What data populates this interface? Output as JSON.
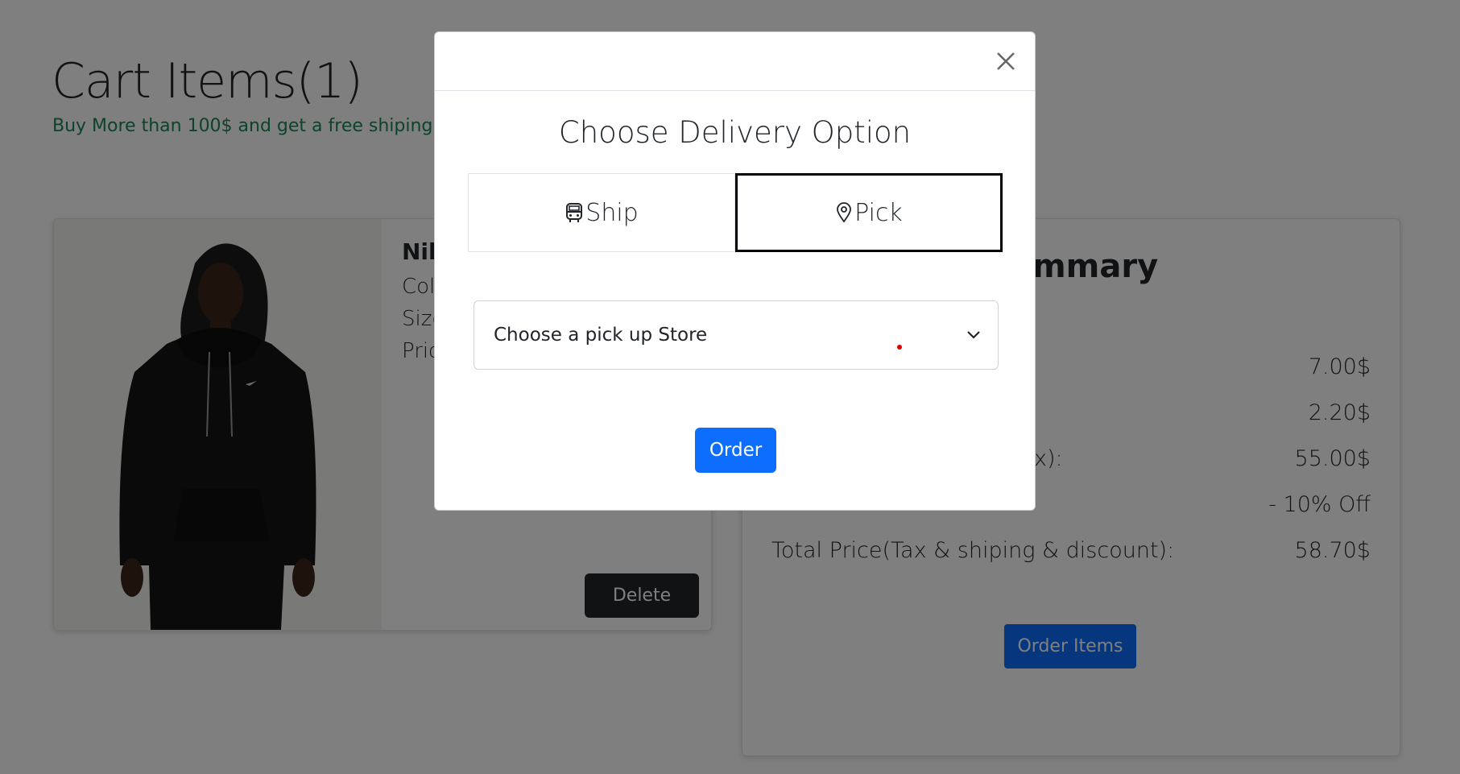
{
  "cart": {
    "title": "Cart Items(1)",
    "promo": "Buy More than 100$ and get a free shiping",
    "item": {
      "name": "Nik",
      "color_label": "Col",
      "size_label": "Size",
      "price_label": "Pric",
      "delete_label": "Delete"
    }
  },
  "summary": {
    "title": "mmary",
    "rows": [
      {
        "label": "",
        "value": "7.00$"
      },
      {
        "label": "",
        "value": "2.20$"
      },
      {
        "label": "x):",
        "value": "55.00$"
      },
      {
        "label": "",
        "value": "- 10% Off"
      },
      {
        "label": "Total Price(Tax & shiping & discount):",
        "value": "58.70$"
      }
    ],
    "order_button": "Order Items"
  },
  "modal": {
    "title": "Choose Delivery Option",
    "tabs": [
      {
        "label": "Ship",
        "icon": "bus-icon",
        "selected": false
      },
      {
        "label": "Pick",
        "icon": "geo-pin-icon",
        "selected": true
      }
    ],
    "store_select": {
      "value": "Choose a pick up Store"
    },
    "order_button": "Order"
  },
  "colors": {
    "primary": "#0d6efd",
    "promo_green": "#198754",
    "dark": "#212529"
  }
}
